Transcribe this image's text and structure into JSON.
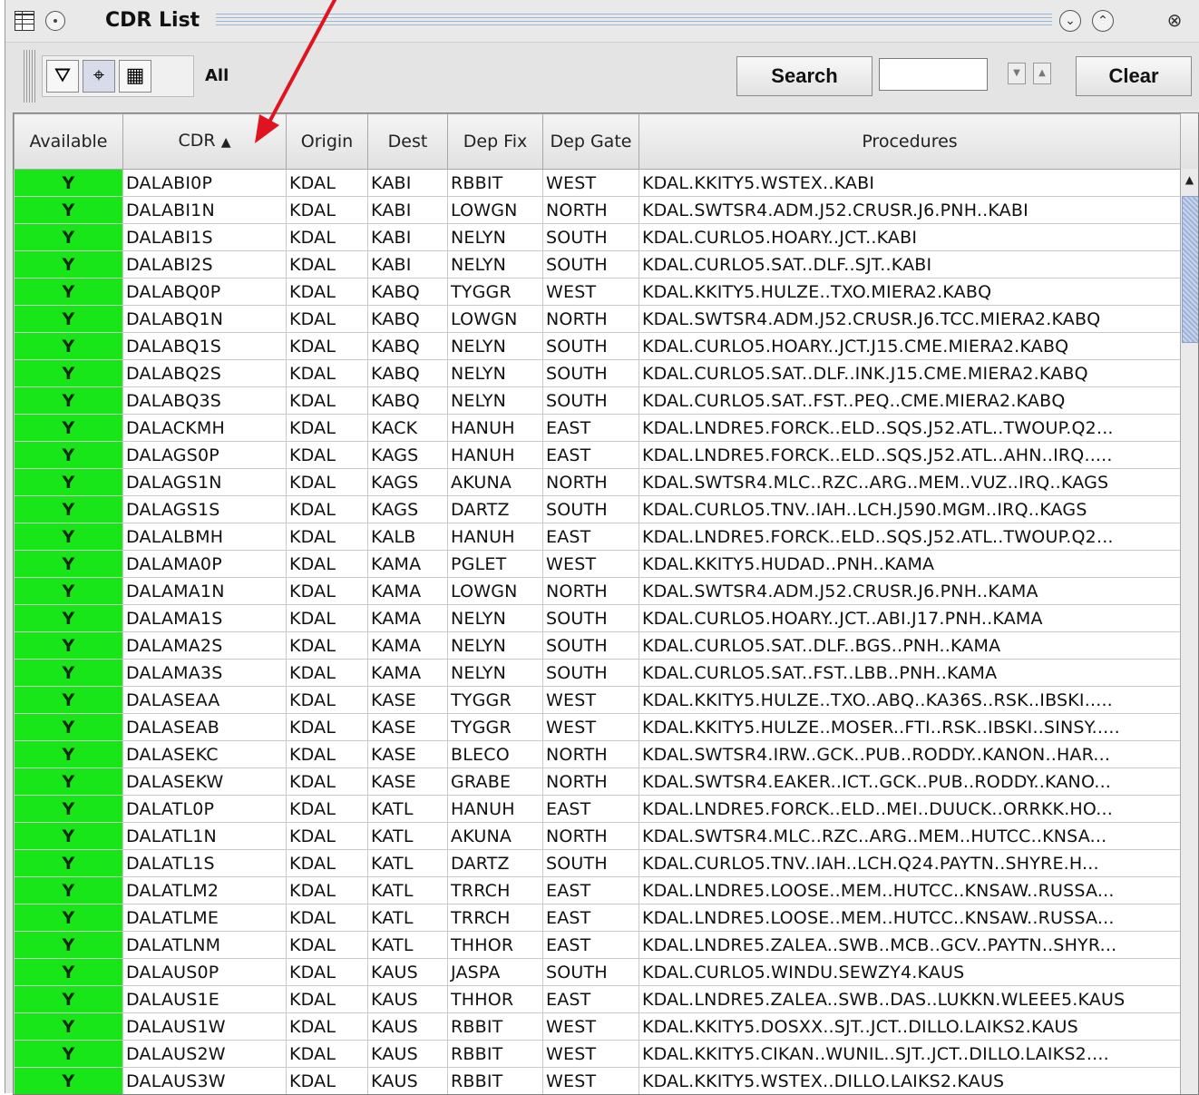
{
  "window": {
    "title": "CDR List"
  },
  "toolbar": {
    "filter_label": "All",
    "search_label": "Search",
    "search_value": "",
    "clear_label": "Clear"
  },
  "table": {
    "columns": [
      "Available",
      "CDR",
      "Origin",
      "Dest",
      "Dep Fix",
      "Dep Gate",
      "Procedures"
    ],
    "sorted_column": "CDR",
    "sort_direction": "ascending",
    "rows": [
      [
        "Y",
        "DALABI0P",
        "KDAL",
        "KABI",
        "RBBIT",
        "WEST",
        "KDAL.KKITY5.WSTEX..KABI"
      ],
      [
        "Y",
        "DALABI1N",
        "KDAL",
        "KABI",
        "LOWGN",
        "NORTH",
        "KDAL.SWTSR4.ADM.J52.CRUSR.J6.PNH..KABI"
      ],
      [
        "Y",
        "DALABI1S",
        "KDAL",
        "KABI",
        "NELYN",
        "SOUTH",
        "KDAL.CURLO5.HOARY..JCT..KABI"
      ],
      [
        "Y",
        "DALABI2S",
        "KDAL",
        "KABI",
        "NELYN",
        "SOUTH",
        "KDAL.CURLO5.SAT..DLF..SJT..KABI"
      ],
      [
        "Y",
        "DALABQ0P",
        "KDAL",
        "KABQ",
        "TYGGR",
        "WEST",
        "KDAL.KKITY5.HULZE..TXO.MIERA2.KABQ"
      ],
      [
        "Y",
        "DALABQ1N",
        "KDAL",
        "KABQ",
        "LOWGN",
        "NORTH",
        "KDAL.SWTSR4.ADM.J52.CRUSR.J6.TCC.MIERA2.KABQ"
      ],
      [
        "Y",
        "DALABQ1S",
        "KDAL",
        "KABQ",
        "NELYN",
        "SOUTH",
        "KDAL.CURLO5.HOARY..JCT.J15.CME.MIERA2.KABQ"
      ],
      [
        "Y",
        "DALABQ2S",
        "KDAL",
        "KABQ",
        "NELYN",
        "SOUTH",
        "KDAL.CURLO5.SAT..DLF..INK.J15.CME.MIERA2.KABQ"
      ],
      [
        "Y",
        "DALABQ3S",
        "KDAL",
        "KABQ",
        "NELYN",
        "SOUTH",
        "KDAL.CURLO5.SAT..FST..PEQ..CME.MIERA2.KABQ"
      ],
      [
        "Y",
        "DALACKMH",
        "KDAL",
        "KACK",
        "HANUH",
        "EAST",
        "KDAL.LNDRE5.FORCK..ELD..SQS.J52.ATL..TWOUP.Q2..."
      ],
      [
        "Y",
        "DALAGS0P",
        "KDAL",
        "KAGS",
        "HANUH",
        "EAST",
        "KDAL.LNDRE5.FORCK..ELD..SQS.J52.ATL..AHN..IRQ....."
      ],
      [
        "Y",
        "DALAGS1N",
        "KDAL",
        "KAGS",
        "AKUNA",
        "NORTH",
        "KDAL.SWTSR4.MLC..RZC..ARG..MEM..VUZ..IRQ..KAGS"
      ],
      [
        "Y",
        "DALAGS1S",
        "KDAL",
        "KAGS",
        "DARTZ",
        "SOUTH",
        "KDAL.CURLO5.TNV..IAH..LCH.J590.MGM..IRQ..KAGS"
      ],
      [
        "Y",
        "DALALBMH",
        "KDAL",
        "KALB",
        "HANUH",
        "EAST",
        "KDAL.LNDRE5.FORCK..ELD..SQS.J52.ATL..TWOUP.Q2..."
      ],
      [
        "Y",
        "DALAMA0P",
        "KDAL",
        "KAMA",
        "PGLET",
        "WEST",
        "KDAL.KKITY5.HUDAD..PNH..KAMA"
      ],
      [
        "Y",
        "DALAMA1N",
        "KDAL",
        "KAMA",
        "LOWGN",
        "NORTH",
        "KDAL.SWTSR4.ADM.J52.CRUSR.J6.PNH..KAMA"
      ],
      [
        "Y",
        "DALAMA1S",
        "KDAL",
        "KAMA",
        "NELYN",
        "SOUTH",
        "KDAL.CURLO5.HOARY..JCT..ABI.J17.PNH..KAMA"
      ],
      [
        "Y",
        "DALAMA2S",
        "KDAL",
        "KAMA",
        "NELYN",
        "SOUTH",
        "KDAL.CURLO5.SAT..DLF..BGS..PNH..KAMA"
      ],
      [
        "Y",
        "DALAMA3S",
        "KDAL",
        "KAMA",
        "NELYN",
        "SOUTH",
        "KDAL.CURLO5.SAT..FST..LBB..PNH..KAMA"
      ],
      [
        "Y",
        "DALASEAA",
        "KDAL",
        "KASE",
        "TYGGR",
        "WEST",
        "KDAL.KKITY5.HULZE..TXO..ABQ..KA36S..RSK..IBSKI....."
      ],
      [
        "Y",
        "DALASEAB",
        "KDAL",
        "KASE",
        "TYGGR",
        "WEST",
        "KDAL.KKITY5.HULZE..MOSER..FTI..RSK..IBSKI..SINSY....."
      ],
      [
        "Y",
        "DALASEKC",
        "KDAL",
        "KASE",
        "BLECO",
        "NORTH",
        "KDAL.SWTSR4.IRW..GCK..PUB..RODDY..KANON..HAR..."
      ],
      [
        "Y",
        "DALASEKW",
        "KDAL",
        "KASE",
        "GRABE",
        "NORTH",
        "KDAL.SWTSR4.EAKER..ICT..GCK..PUB..RODDY..KANO..."
      ],
      [
        "Y",
        "DALATL0P",
        "KDAL",
        "KATL",
        "HANUH",
        "EAST",
        "KDAL.LNDRE5.FORCK..ELD..MEI..DUUCK..ORRKK.HO..."
      ],
      [
        "Y",
        "DALATL1N",
        "KDAL",
        "KATL",
        "AKUNA",
        "NORTH",
        "KDAL.SWTSR4.MLC..RZC..ARG..MEM..HUTCC..KNSA..."
      ],
      [
        "Y",
        "DALATL1S",
        "KDAL",
        "KATL",
        "DARTZ",
        "SOUTH",
        "KDAL.CURLO5.TNV..IAH..LCH.Q24.PAYTN..SHYRE.H..."
      ],
      [
        "Y",
        "DALATLM2",
        "KDAL",
        "KATL",
        "TRRCH",
        "EAST",
        "KDAL.LNDRE5.LOOSE..MEM..HUTCC..KNSAW..RUSSA..."
      ],
      [
        "Y",
        "DALATLME",
        "KDAL",
        "KATL",
        "TRRCH",
        "EAST",
        "KDAL.LNDRE5.LOOSE..MEM..HUTCC..KNSAW..RUSSA..."
      ],
      [
        "Y",
        "DALATLNM",
        "KDAL",
        "KATL",
        "THHOR",
        "EAST",
        "KDAL.LNDRE5.ZALEA..SWB..MCB..GCV..PAYTN..SHYR..."
      ],
      [
        "Y",
        "DALAUS0P",
        "KDAL",
        "KAUS",
        "JASPA",
        "SOUTH",
        "KDAL.CURLO5.WINDU.SEWZY4.KAUS"
      ],
      [
        "Y",
        "DALAUS1E",
        "KDAL",
        "KAUS",
        "THHOR",
        "EAST",
        "KDAL.LNDRE5.ZALEA..SWB..DAS..LUKKN.WLEEE5.KAUS"
      ],
      [
        "Y",
        "DALAUS1W",
        "KDAL",
        "KAUS",
        "RBBIT",
        "WEST",
        "KDAL.KKITY5.DOSXX..SJT..JCT..DILLO.LAIKS2.KAUS"
      ],
      [
        "Y",
        "DALAUS2W",
        "KDAL",
        "KAUS",
        "RBBIT",
        "WEST",
        "KDAL.KKITY5.CIKAN..WUNIL..SJT..JCT..DILLO.LAIKS2...."
      ],
      [
        "Y",
        "DALAUS3W",
        "KDAL",
        "KAUS",
        "RBBIT",
        "WEST",
        "KDAL.KKITY5.WSTEX..DILLO.LAIKS2.KAUS"
      ]
    ]
  },
  "colors": {
    "available_bg": "#19e619",
    "annotation_arrow": "#e0141e"
  },
  "annotation": {
    "icon": "red-pointer-arrow"
  }
}
